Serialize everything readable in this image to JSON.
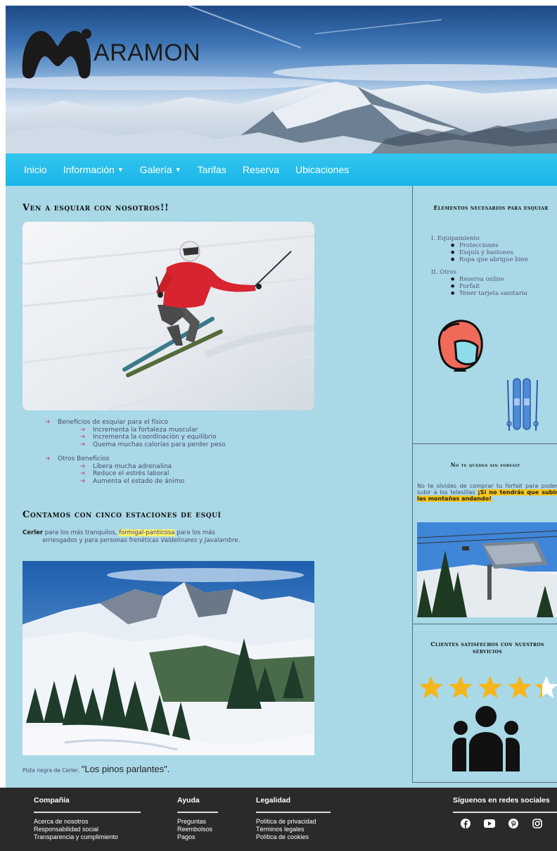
{
  "brand": {
    "name": "ARAMON"
  },
  "nav": {
    "items": [
      {
        "label": "Inicio"
      },
      {
        "label": "Información",
        "dropdown": true
      },
      {
        "label": "Galería",
        "dropdown": true
      },
      {
        "label": "Tarifas"
      },
      {
        "label": "Reserva"
      },
      {
        "label": "Ubicaciones"
      }
    ],
    "caret": "▼"
  },
  "main": {
    "title1": "Ven a esquiar con nosotros!!",
    "benefits": {
      "group1": {
        "label": "Beneficios de esquiar para el físico",
        "items": [
          "Incrementa la fortaleza muscular",
          "Incrementa la coordinación y equilibrio",
          "Quema muchas calorías para perder peso"
        ]
      },
      "group2": {
        "label": "Otros Beneficios",
        "items": [
          "Libera mucha adrenalina",
          "Reduce el estrés laboral",
          "Aumenta el estado de ánimo"
        ]
      }
    },
    "title2": "Contamos con cinco estaciones de esquí",
    "stations": {
      "s1": "Cerler",
      "t1": " para los más tranquilos, ",
      "s2": "formigal-panticosa",
      "t2": " para los más",
      "t3": "arriesgados y para personas frenéticas ",
      "s3": "Valdelinares",
      "t4": " y ",
      "s4": "Javalambre",
      "t5": "."
    },
    "caption": {
      "small": "Pista negra de Cerler, ",
      "big": "\"Los pinos parlantes\"."
    }
  },
  "sidebar": {
    "title1": "Elementos necesarios para esquiar",
    "list": [
      {
        "marker": "I.",
        "label": "Equipamiento",
        "items": [
          "Protecciones",
          "Esquís y bastones",
          "Ropa que abrigue bien"
        ]
      },
      {
        "marker": "II.",
        "label": "Otros",
        "items": [
          "Reserva online",
          "Forfait",
          "Tener tarjeta sanitaria"
        ]
      }
    ],
    "title2": "No te quedes sin forfait",
    "forfait_text": "No te olvides de comprar tu forfait para poder subir a los telesillas ",
    "forfait_highlight": "¡Si no tendrás que subir las montañas andando!",
    "title3": "Clientes satisfechos con nuestros servicios",
    "rating": 4.5,
    "colors": {
      "star": "#f6b51a",
      "helmet": "#f06a5a",
      "skis": "#4f8ad9"
    }
  },
  "footer": {
    "col1": {
      "head": "Compañía",
      "links": [
        "Acerca de nosotros",
        "Responsabilidad social",
        "Transparencia y cumplimiento"
      ]
    },
    "col2": {
      "head": "Ayuda",
      "links": [
        "Preguntas",
        "Reembolsos",
        "Pagos"
      ]
    },
    "col3": {
      "head": "Legalidad",
      "links": [
        "Política de privacidad",
        "Términos legales",
        "Política de cookies"
      ]
    },
    "col4": {
      "head": "Síguenos en redes sociales",
      "icons": [
        "facebook-icon",
        "youtube-icon",
        "pinterest-icon",
        "instagram-icon"
      ]
    }
  }
}
